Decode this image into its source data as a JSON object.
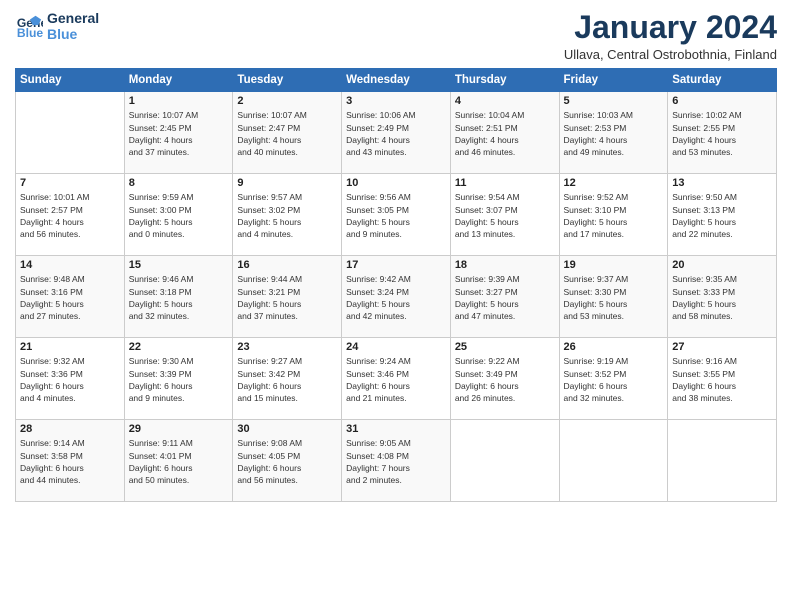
{
  "logo": {
    "line1": "General",
    "line2": "Blue"
  },
  "title": "January 2024",
  "subtitle": "Ullava, Central Ostrobothnia, Finland",
  "days_header": [
    "Sunday",
    "Monday",
    "Tuesday",
    "Wednesday",
    "Thursday",
    "Friday",
    "Saturday"
  ],
  "weeks": [
    [
      {
        "day": "",
        "info": ""
      },
      {
        "day": "1",
        "info": "Sunrise: 10:07 AM\nSunset: 2:45 PM\nDaylight: 4 hours\nand 37 minutes."
      },
      {
        "day": "2",
        "info": "Sunrise: 10:07 AM\nSunset: 2:47 PM\nDaylight: 4 hours\nand 40 minutes."
      },
      {
        "day": "3",
        "info": "Sunrise: 10:06 AM\nSunset: 2:49 PM\nDaylight: 4 hours\nand 43 minutes."
      },
      {
        "day": "4",
        "info": "Sunrise: 10:04 AM\nSunset: 2:51 PM\nDaylight: 4 hours\nand 46 minutes."
      },
      {
        "day": "5",
        "info": "Sunrise: 10:03 AM\nSunset: 2:53 PM\nDaylight: 4 hours\nand 49 minutes."
      },
      {
        "day": "6",
        "info": "Sunrise: 10:02 AM\nSunset: 2:55 PM\nDaylight: 4 hours\nand 53 minutes."
      }
    ],
    [
      {
        "day": "7",
        "info": "Sunrise: 10:01 AM\nSunset: 2:57 PM\nDaylight: 4 hours\nand 56 minutes."
      },
      {
        "day": "8",
        "info": "Sunrise: 9:59 AM\nSunset: 3:00 PM\nDaylight: 5 hours\nand 0 minutes."
      },
      {
        "day": "9",
        "info": "Sunrise: 9:57 AM\nSunset: 3:02 PM\nDaylight: 5 hours\nand 4 minutes."
      },
      {
        "day": "10",
        "info": "Sunrise: 9:56 AM\nSunset: 3:05 PM\nDaylight: 5 hours\nand 9 minutes."
      },
      {
        "day": "11",
        "info": "Sunrise: 9:54 AM\nSunset: 3:07 PM\nDaylight: 5 hours\nand 13 minutes."
      },
      {
        "day": "12",
        "info": "Sunrise: 9:52 AM\nSunset: 3:10 PM\nDaylight: 5 hours\nand 17 minutes."
      },
      {
        "day": "13",
        "info": "Sunrise: 9:50 AM\nSunset: 3:13 PM\nDaylight: 5 hours\nand 22 minutes."
      }
    ],
    [
      {
        "day": "14",
        "info": "Sunrise: 9:48 AM\nSunset: 3:16 PM\nDaylight: 5 hours\nand 27 minutes."
      },
      {
        "day": "15",
        "info": "Sunrise: 9:46 AM\nSunset: 3:18 PM\nDaylight: 5 hours\nand 32 minutes."
      },
      {
        "day": "16",
        "info": "Sunrise: 9:44 AM\nSunset: 3:21 PM\nDaylight: 5 hours\nand 37 minutes."
      },
      {
        "day": "17",
        "info": "Sunrise: 9:42 AM\nSunset: 3:24 PM\nDaylight: 5 hours\nand 42 minutes."
      },
      {
        "day": "18",
        "info": "Sunrise: 9:39 AM\nSunset: 3:27 PM\nDaylight: 5 hours\nand 47 minutes."
      },
      {
        "day": "19",
        "info": "Sunrise: 9:37 AM\nSunset: 3:30 PM\nDaylight: 5 hours\nand 53 minutes."
      },
      {
        "day": "20",
        "info": "Sunrise: 9:35 AM\nSunset: 3:33 PM\nDaylight: 5 hours\nand 58 minutes."
      }
    ],
    [
      {
        "day": "21",
        "info": "Sunrise: 9:32 AM\nSunset: 3:36 PM\nDaylight: 6 hours\nand 4 minutes."
      },
      {
        "day": "22",
        "info": "Sunrise: 9:30 AM\nSunset: 3:39 PM\nDaylight: 6 hours\nand 9 minutes."
      },
      {
        "day": "23",
        "info": "Sunrise: 9:27 AM\nSunset: 3:42 PM\nDaylight: 6 hours\nand 15 minutes."
      },
      {
        "day": "24",
        "info": "Sunrise: 9:24 AM\nSunset: 3:46 PM\nDaylight: 6 hours\nand 21 minutes."
      },
      {
        "day": "25",
        "info": "Sunrise: 9:22 AM\nSunset: 3:49 PM\nDaylight: 6 hours\nand 26 minutes."
      },
      {
        "day": "26",
        "info": "Sunrise: 9:19 AM\nSunset: 3:52 PM\nDaylight: 6 hours\nand 32 minutes."
      },
      {
        "day": "27",
        "info": "Sunrise: 9:16 AM\nSunset: 3:55 PM\nDaylight: 6 hours\nand 38 minutes."
      }
    ],
    [
      {
        "day": "28",
        "info": "Sunrise: 9:14 AM\nSunset: 3:58 PM\nDaylight: 6 hours\nand 44 minutes."
      },
      {
        "day": "29",
        "info": "Sunrise: 9:11 AM\nSunset: 4:01 PM\nDaylight: 6 hours\nand 50 minutes."
      },
      {
        "day": "30",
        "info": "Sunrise: 9:08 AM\nSunset: 4:05 PM\nDaylight: 6 hours\nand 56 minutes."
      },
      {
        "day": "31",
        "info": "Sunrise: 9:05 AM\nSunset: 4:08 PM\nDaylight: 7 hours\nand 2 minutes."
      },
      {
        "day": "",
        "info": ""
      },
      {
        "day": "",
        "info": ""
      },
      {
        "day": "",
        "info": ""
      }
    ]
  ]
}
